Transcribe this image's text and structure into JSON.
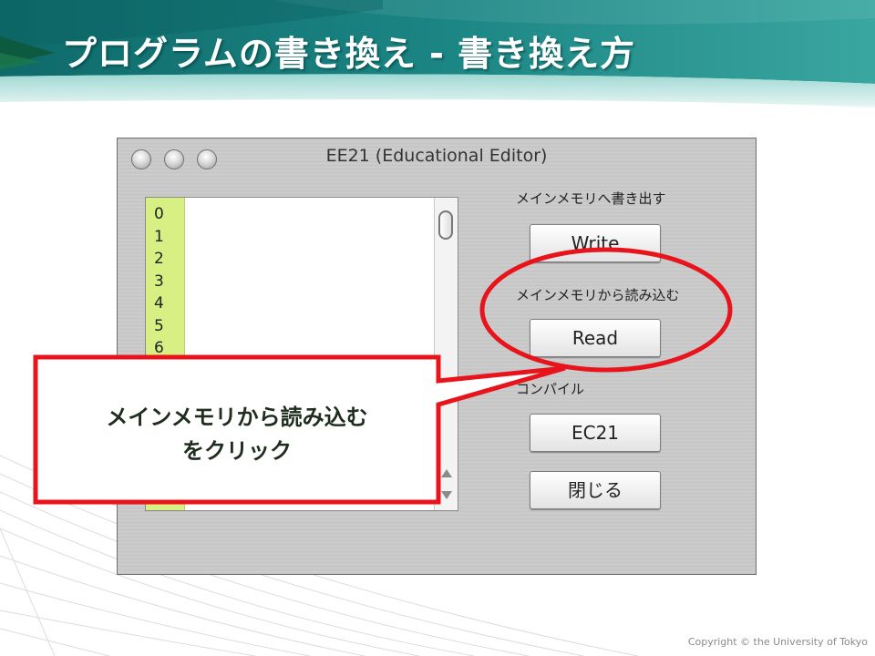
{
  "slide": {
    "title": "プログラムの書き換え - 書き換え方",
    "copyright": "Copyright © the University of Tokyo"
  },
  "window": {
    "title": "EE21 (Educational Editor)",
    "line_numbers": [
      "0",
      "1",
      "2",
      "3",
      "4",
      "5",
      "6"
    ],
    "sections": {
      "write_label": "メインメモリへ書き出す",
      "read_label": "メインメモリから読み込む",
      "compile_label": "コンパイル"
    },
    "buttons": {
      "write": "Write",
      "read": "Read",
      "ec21": "EC21",
      "close": "閉じる"
    }
  },
  "callout": {
    "line1": "メインメモリから読み込む",
    "line2": "をクリック"
  },
  "colors": {
    "highlight_red": "#e8141c",
    "header_teal": "#1f8c8a",
    "line_number_green": "#d8ef84"
  }
}
